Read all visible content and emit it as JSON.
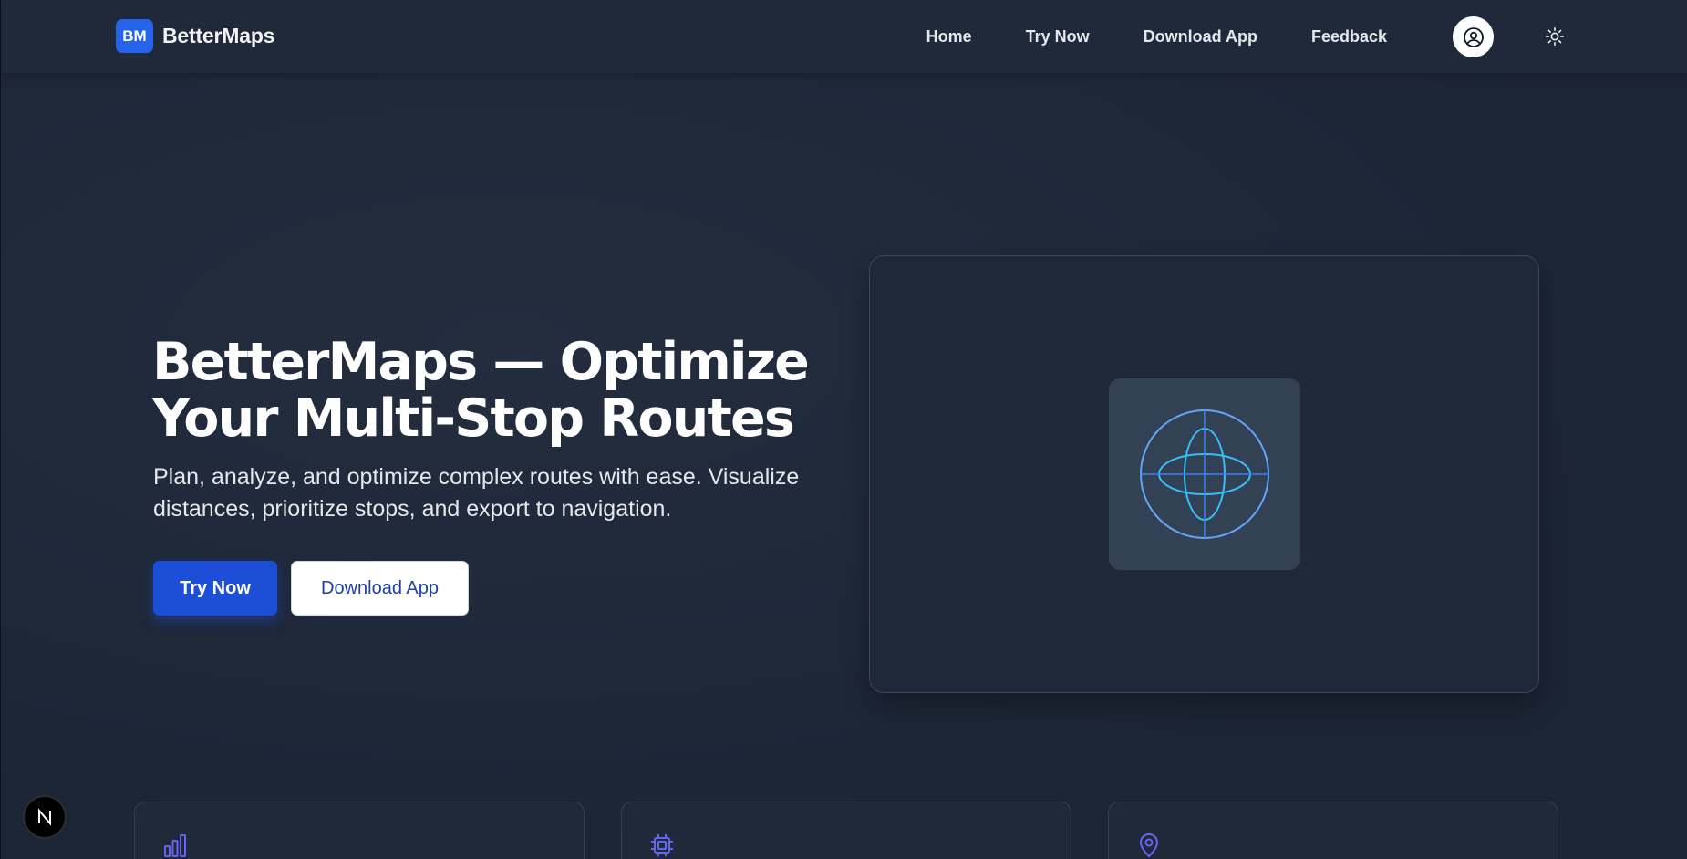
{
  "header": {
    "logo_badge": "BM",
    "app_name": "BetterMaps",
    "nav": [
      "Home",
      "Try Now",
      "Download App",
      "Feedback"
    ]
  },
  "hero": {
    "title_line1": "BetterMaps — Optimize",
    "title_line2": "Your Multi-Stop Routes",
    "subtitle_line1": "Plan, analyze, and optimize complex routes with ease. Visualize",
    "subtitle_line2": "distances, prioritize stops, and export to navigation.",
    "primary_button": "Try Now",
    "secondary_button": "Download App"
  },
  "features": [
    {
      "icon": "bar-chart-icon"
    },
    {
      "icon": "cpu-chip-icon"
    },
    {
      "icon": "map-pin-icon"
    }
  ],
  "colors": {
    "background": "#1e2738",
    "accent": "#2563eb",
    "globe_stroke": "#60a5fa",
    "feature_icon": "#6366f1"
  }
}
